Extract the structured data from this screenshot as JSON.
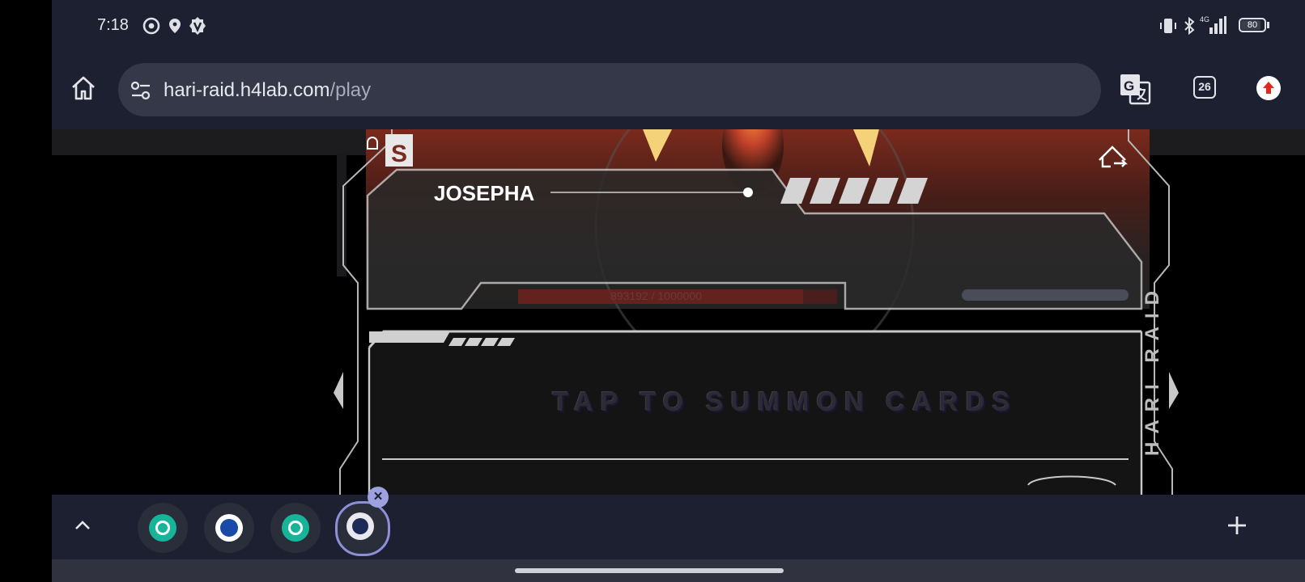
{
  "status_bar": {
    "time": "7:18",
    "battery": "80",
    "network": "4G",
    "icons": [
      "chrome-icon",
      "location-pin-icon",
      "v-badge-icon",
      "vibrate-icon",
      "bluetooth-icon",
      "signal-icon",
      "battery-icon"
    ]
  },
  "toolbar": {
    "url_host": "hari-raid.h4lab.com",
    "url_path": "/play",
    "tab_count": "26",
    "icons": [
      "home-icon",
      "site-settings-icon",
      "translate-icon",
      "tab-switcher-icon",
      "update-icon"
    ]
  },
  "game": {
    "player_name": "JOSEPHA",
    "boss_hp": "893192 / 1000000",
    "boss_hp_fraction": 0.893,
    "summon_label": "TAP TO SUMMON CARDS",
    "brand_vertical": "HARI RAID",
    "logo_letter": "S",
    "colors": {
      "accent_red": "#c0412a",
      "frame": "#c8c8c8",
      "summon_shadow": "#2a1f5c"
    }
  },
  "bottom_bar": {
    "tab_group_icons": [
      "chatgpt-tab-icon",
      "blue-globe-tab-icon",
      "chatgpt-tab-icon",
      "hari-raid-tab-icon"
    ],
    "icons": [
      "expand-up-icon",
      "close-tab-icon",
      "new-tab-plus-icon"
    ]
  }
}
